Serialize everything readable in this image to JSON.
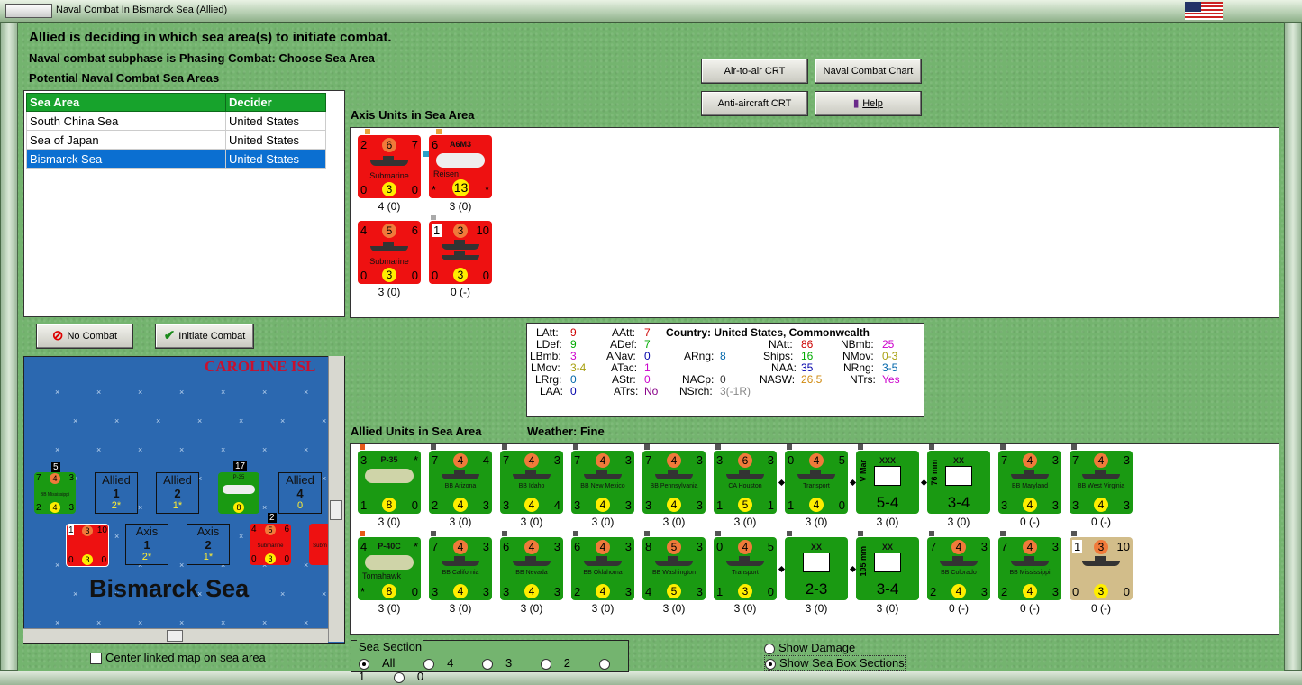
{
  "window": {
    "title": "Naval Combat In Bismarck Sea (Allied)"
  },
  "header": {
    "line1": "Allied is deciding in which sea area(s) to initiate combat.",
    "line2": "Naval combat subphase is Phasing Combat: Choose Sea Area",
    "line3": "Potential Naval Combat Sea Areas"
  },
  "sea_table": {
    "columns": [
      "Sea Area",
      "Decider"
    ],
    "rows": [
      [
        "South China Sea",
        "United States"
      ],
      [
        "Sea of Japan",
        "United States"
      ],
      [
        "Bismarck Sea",
        "United States"
      ]
    ],
    "selected_row": 2
  },
  "buttons": {
    "air_to_air": "Air-to-air CRT",
    "naval_chart": "Naval Combat Chart",
    "anti_aircraft": "Anti-aircraft CRT",
    "help": "Help",
    "no_combat": "No Combat",
    "initiate": "Initiate Combat"
  },
  "axis": {
    "label": "Axis Units in Sea Area",
    "units": [
      {
        "tl": "2",
        "tm": "6",
        "tr": "7",
        "name": "Submarine",
        "bl": "0",
        "bm": "3",
        "br": "0",
        "cap": "4 (0)"
      },
      {
        "tl": "6",
        "tm": "A6M3",
        "tr": "",
        "name": "Reisen",
        "bl": "*",
        "bm": "13",
        "br": "*",
        "cap": "3 (0)"
      },
      {
        "tl": "4",
        "tm": "5",
        "tr": "6",
        "name": "Submarine",
        "bl": "0",
        "bm": "3",
        "br": "0",
        "cap": "3 (0)"
      },
      {
        "tl": "1",
        "tm": "3",
        "tr": "10",
        "name": "",
        "bl": "0",
        "bm": "3",
        "br": "0",
        "cap": "0 (-)"
      }
    ]
  },
  "info": {
    "country": "Country: United States, Commonwealth",
    "LAtt": "9",
    "LDef": "9",
    "LBmb": "3",
    "LMov": "3-4",
    "LRrg": "0",
    "LAA": "0",
    "AAtt": "7",
    "ADef": "7",
    "ANav": "0",
    "ATac": "1",
    "AStr": "0",
    "ATrs": "No",
    "ARng": "8",
    "NACp": "0",
    "NSrch": "3(-1R)",
    "NAtt": "86",
    "Ships": "16",
    "NAA": "35",
    "NASW": "26.5",
    "NBmb": "25",
    "NMov": "0-3",
    "NRng": "3-5",
    "NTrs": "Yes"
  },
  "allied": {
    "label": "Allied Units in Sea Area",
    "weather": "Weather:  Fine",
    "row1": [
      {
        "tl": "3",
        "tm": "P-35",
        "tr": "*",
        "name": "",
        "bl": "1",
        "bm": "8",
        "br": "0",
        "cap": "3 (0)",
        "kind": "plane"
      },
      {
        "tl": "7",
        "tm": "4",
        "tr": "4",
        "name": "BB Arizona",
        "bl": "2",
        "bm": "4",
        "br": "3",
        "cap": "3 (0)",
        "kind": "ship"
      },
      {
        "tl": "7",
        "tm": "4",
        "tr": "3",
        "name": "BB Idaho",
        "bl": "3",
        "bm": "4",
        "br": "4",
        "cap": "3 (0)",
        "kind": "ship"
      },
      {
        "tl": "7",
        "tm": "4",
        "tr": "3",
        "name": "BB New Mexico",
        "bl": "3",
        "bm": "4",
        "br": "3",
        "cap": "3 (0)",
        "kind": "ship"
      },
      {
        "tl": "7",
        "tm": "4",
        "tr": "3",
        "name": "BB Pennsylvania",
        "bl": "3",
        "bm": "4",
        "br": "3",
        "cap": "3 (0)",
        "kind": "ship"
      },
      {
        "tl": "3",
        "tm": "6",
        "tr": "3",
        "name": "CA Houston",
        "bl": "1",
        "bm": "5",
        "br": "1",
        "cap": "3 (0)",
        "kind": "ship"
      },
      {
        "tl": "0",
        "tm": "4",
        "tr": "5",
        "name": "Transport",
        "bl": "1",
        "bm": "4",
        "br": "0",
        "cap": "3 (0)",
        "kind": "ship"
      },
      {
        "tl": "XXX",
        "tm": "V Mar",
        "tr": "",
        "name": "",
        "bl": "",
        "bm": "5-4",
        "br": "",
        "cap": "3 (0)",
        "kind": "army"
      },
      {
        "tl": "XX",
        "tm": "76 mm",
        "tr": "",
        "name": "",
        "bl": "",
        "bm": "3-4",
        "br": "",
        "cap": "3 (0)",
        "kind": "army"
      },
      {
        "tl": "7",
        "tm": "4",
        "tr": "3",
        "name": "BB Maryland",
        "bl": "3",
        "bm": "4",
        "br": "3",
        "cap": "0 (-)",
        "kind": "ship"
      },
      {
        "tl": "7",
        "tm": "4",
        "tr": "3",
        "name": "BB West Virginia",
        "bl": "3",
        "bm": "4",
        "br": "3",
        "cap": "0 (-)",
        "kind": "ship"
      }
    ],
    "row2": [
      {
        "tl": "4",
        "tm": "P-40C",
        "tr": "*",
        "name": "Tomahawk",
        "bl": "*",
        "bm": "8",
        "br": "0",
        "cap": "3 (0)",
        "kind": "plane"
      },
      {
        "tl": "7",
        "tm": "4",
        "tr": "3",
        "name": "BB California",
        "bl": "3",
        "bm": "4",
        "br": "3",
        "cap": "3 (0)",
        "kind": "ship"
      },
      {
        "tl": "6",
        "tm": "4",
        "tr": "3",
        "name": "BB Nevada",
        "bl": "3",
        "bm": "4",
        "br": "3",
        "cap": "3 (0)",
        "kind": "ship"
      },
      {
        "tl": "6",
        "tm": "4",
        "tr": "3",
        "name": "BB Oklahoma",
        "bl": "2",
        "bm": "4",
        "br": "3",
        "cap": "3 (0)",
        "kind": "ship"
      },
      {
        "tl": "8",
        "tm": "5",
        "tr": "3",
        "name": "BB Washington",
        "bl": "4",
        "bm": "5",
        "br": "3",
        "cap": "3 (0)",
        "kind": "ship"
      },
      {
        "tl": "0",
        "tm": "4",
        "tr": "5",
        "name": "Transport",
        "bl": "1",
        "bm": "3",
        "br": "0",
        "cap": "3 (0)",
        "kind": "ship"
      },
      {
        "tl": "XX",
        "tm": "",
        "tr": "",
        "name": "",
        "bl": "",
        "bm": "2-3",
        "br": "",
        "cap": "3 (0)",
        "kind": "army"
      },
      {
        "tl": "XX",
        "tm": "105 mm",
        "tr": "",
        "name": "",
        "bl": "",
        "bm": "3-4",
        "br": "",
        "cap": "3 (0)",
        "kind": "army"
      },
      {
        "tl": "7",
        "tm": "4",
        "tr": "3",
        "name": "BB Colorado",
        "bl": "2",
        "bm": "4",
        "br": "3",
        "cap": "0 (-)",
        "kind": "ship"
      },
      {
        "tl": "7",
        "tm": "4",
        "tr": "3",
        "name": "BB Mississippi",
        "bl": "2",
        "bm": "4",
        "br": "3",
        "cap": "0 (-)",
        "kind": "ship"
      },
      {
        "tl": "1",
        "tm": "3",
        "tr": "10",
        "name": "",
        "bl": "0",
        "bm": "3",
        "br": "0",
        "cap": "0 (-)",
        "kind": "tan"
      }
    ]
  },
  "map": {
    "title": "CAROLINE ISL",
    "name": "Bismarck Sea",
    "stack1_count": "5",
    "stack2_count": "17",
    "stack3_count": "2",
    "allied_boxes": [
      {
        "side": "Allied",
        "sec": "1",
        "val": "2*"
      },
      {
        "side": "Allied",
        "sec": "2",
        "val": "1*"
      },
      {
        "side": "Allied",
        "sec": "4",
        "val": "0"
      }
    ],
    "axis_boxes": [
      {
        "side": "Axis",
        "sec": "1",
        "val": "2*"
      },
      {
        "side": "Axis",
        "sec": "2",
        "val": "1*"
      }
    ],
    "mini1": {
      "tl": "7",
      "tm": "4",
      "tr": "3",
      "name": "BB Mississippi",
      "bl": "2",
      "bm": "4",
      "br": "3"
    },
    "mini2": {
      "tm": "P-35",
      "bm": "8"
    },
    "mini3": {
      "tl": "1",
      "tm": "3",
      "tr": "10",
      "bl": "0",
      "bm": "3",
      "br": "0"
    },
    "mini4": {
      "tl": "4",
      "tm": "5",
      "tr": "6",
      "name": "Submarine",
      "bl": "0",
      "bm": "3",
      "br": "0"
    },
    "mini5": {
      "name": "Subm"
    }
  },
  "center_link": "Center linked map on sea area",
  "sea_section": {
    "label": "Sea Section",
    "options": [
      "All",
      "4",
      "3",
      "2",
      "1",
      "0"
    ],
    "selected": "All"
  },
  "show_damage": "Show Damage",
  "show_sections": "Show Sea Box Sections"
}
